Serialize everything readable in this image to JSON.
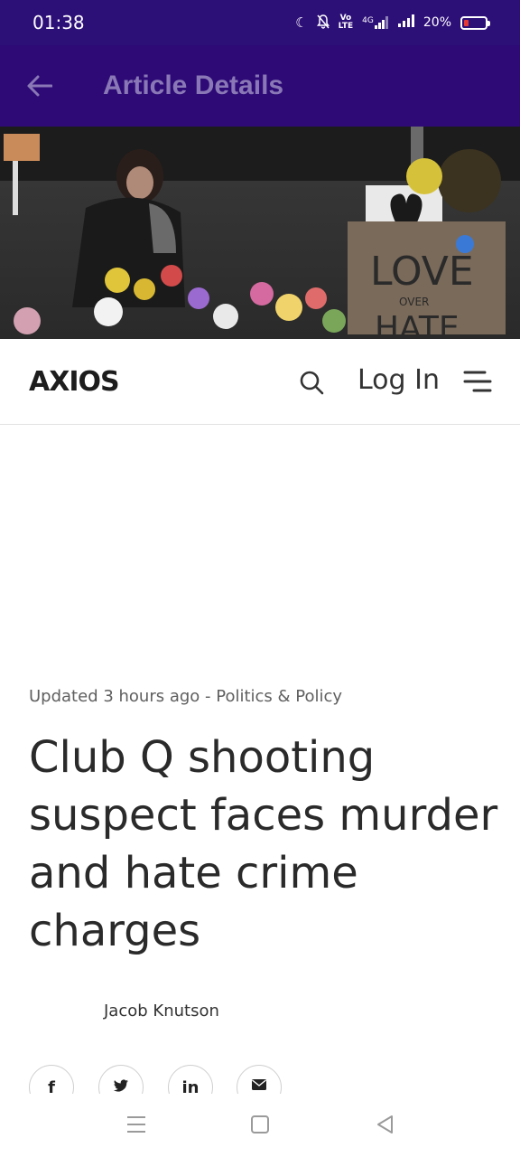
{
  "status_bar": {
    "time": "01:38",
    "network": "4G",
    "volte": "Vo LTE",
    "battery_percent": "20%",
    "battery_level": 0.2,
    "icons": [
      "moon-icon",
      "bell-off-icon",
      "volte-icon",
      "signal-4g-icon",
      "signal-icon",
      "battery-icon"
    ]
  },
  "app_bar": {
    "title": "Article Details",
    "back_icon": "arrow-left-icon",
    "background": "#2d0a76",
    "title_color": "#8a78b6"
  },
  "hero_image": {
    "sign_text_line1": "LOVE",
    "sign_text_line2": "OVER",
    "sign_text_line3": "HATE"
  },
  "site_header": {
    "logo": "AXIOS",
    "login_label": "Log In",
    "search_icon": "search-icon",
    "menu_icon": "menu-icon"
  },
  "article": {
    "meta": "Updated 3 hours ago - Politics & Policy",
    "headline": "Club Q shooting suspect faces murder and hate crime charges",
    "author": "Jacob Knutson",
    "share": [
      {
        "icon": "facebook-icon",
        "glyph": "f"
      },
      {
        "icon": "twitter-icon",
        "glyph": "🐦"
      },
      {
        "icon": "linkedin-icon",
        "glyph": "in"
      },
      {
        "icon": "email-icon",
        "glyph": "✉"
      }
    ]
  },
  "nav_bar": {
    "icons": [
      "menu-lines-icon",
      "home-square-icon",
      "back-triangle-icon"
    ]
  }
}
